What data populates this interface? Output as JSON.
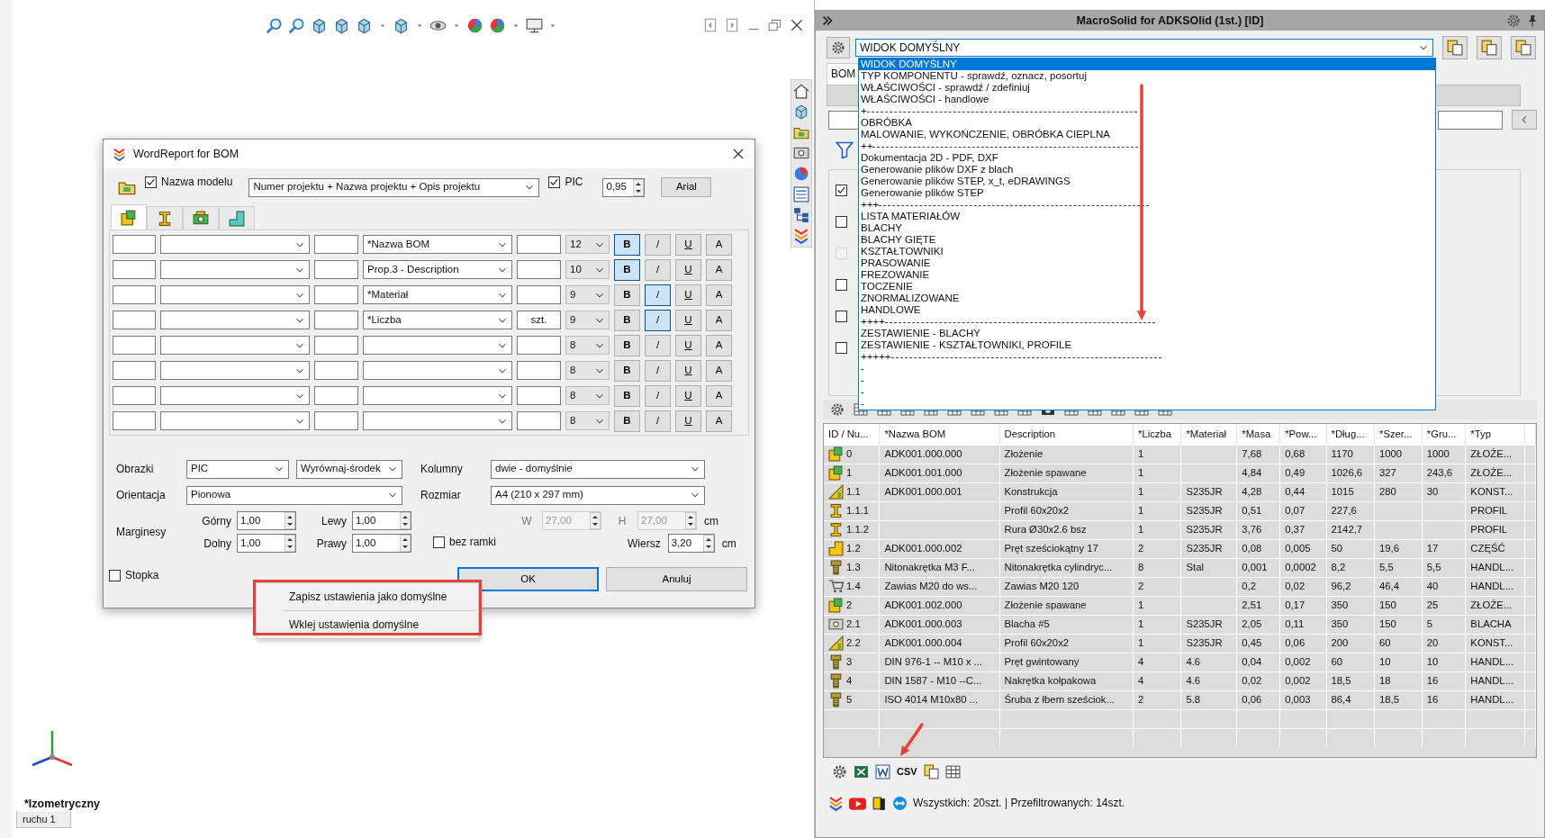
{
  "viewport": {
    "view_name": "*Izometryczny",
    "sheet_tab": "ruchu 1"
  },
  "dialog": {
    "title": "WordReport for BOM",
    "model_name": {
      "label": "Nazwa modelu",
      "checked": true
    },
    "title_source": "Numer projektu + Nazwa projektu + Opis projektu",
    "pic": {
      "label": "PIC",
      "checked": true
    },
    "scale": "0,95",
    "font_button": "Arial",
    "tabs": [
      {
        "kind": "assembly",
        "selected": true
      },
      {
        "kind": "profile",
        "selected": false
      },
      {
        "kind": "sheet",
        "selected": false
      },
      {
        "kind": "part",
        "selected": false
      }
    ],
    "rows": [
      {
        "property": "*Nazwa BOM",
        "size": "12",
        "styles": [
          {
            "label": "B",
            "selected": true
          },
          {
            "label": "/",
            "selected": false
          },
          {
            "label": "U",
            "selected": false
          },
          {
            "label": "A",
            "selected": false
          }
        ]
      },
      {
        "property": "Prop.3 - Description",
        "size": "10",
        "styles": [
          {
            "label": "B",
            "selected": true
          },
          {
            "label": "/",
            "selected": false
          },
          {
            "label": "U",
            "selected": false
          },
          {
            "label": "A",
            "selected": false
          }
        ]
      },
      {
        "property": "*Materiał",
        "size": "9",
        "styles": [
          {
            "label": "B",
            "selected": false
          },
          {
            "label": "/",
            "selected": true
          },
          {
            "label": "U",
            "selected": false
          },
          {
            "label": "A",
            "selected": false
          }
        ]
      },
      {
        "property": "*Liczba",
        "unit": "szt.",
        "size": "9",
        "styles": [
          {
            "label": "B",
            "selected": false
          },
          {
            "label": "/",
            "selected": true
          },
          {
            "label": "U",
            "selected": false
          },
          {
            "label": "A",
            "selected": false
          }
        ]
      },
      {
        "size": "8",
        "styles": [
          {
            "label": "B",
            "selected": false
          },
          {
            "label": "/",
            "selected": false
          },
          {
            "label": "U",
            "selected": false
          },
          {
            "label": "A",
            "selected": false
          }
        ]
      },
      {
        "size": "8",
        "styles": [
          {
            "label": "B",
            "selected": false
          },
          {
            "label": "/",
            "selected": false
          },
          {
            "label": "U",
            "selected": false
          },
          {
            "label": "A",
            "selected": false
          }
        ]
      },
      {
        "size": "8",
        "styles": [
          {
            "label": "B",
            "selected": false
          },
          {
            "label": "/",
            "selected": false
          },
          {
            "label": "U",
            "selected": false
          },
          {
            "label": "A",
            "selected": false
          }
        ]
      },
      {
        "size": "8",
        "styles": [
          {
            "label": "B",
            "selected": false
          },
          {
            "label": "/",
            "selected": false
          },
          {
            "label": "U",
            "selected": false
          },
          {
            "label": "A",
            "selected": false
          }
        ]
      }
    ],
    "images": {
      "label": "Obrazki",
      "source": "PIC",
      "align": "Wyrównaj-środek"
    },
    "columns": {
      "label": "Kolumny",
      "value": "dwie - domyślnie"
    },
    "orientation": {
      "label": "Orientacja",
      "value": "Pionowa"
    },
    "size": {
      "label": "Rozmiar",
      "value": "A4 (210 x 297 mm)"
    },
    "margins": {
      "label": "Marginesy",
      "fields": [
        {
          "label": "Górny",
          "value": "1,00"
        },
        {
          "label": "Lewy",
          "value": "1,00"
        },
        {
          "label": "Dolny",
          "value": "1,00"
        },
        {
          "label": "Prawy",
          "value": "1,00"
        }
      ]
    },
    "custom_size": [
      {
        "label": "W",
        "value": "27,00",
        "disabled": true
      },
      {
        "label": "H",
        "value": "27,00",
        "disabled": true
      }
    ],
    "custom_unit": "cm",
    "no_frame": {
      "label": "bez ramki",
      "checked": false
    },
    "row_height": {
      "label": "Wiersz",
      "value": "3,20",
      "unit": "cm"
    },
    "footer": {
      "label": "Stopka",
      "checked": false
    },
    "buttons": [
      {
        "label": "OK",
        "default": true
      },
      {
        "label": "Anuluj",
        "default": false
      }
    ]
  },
  "context_menu": {
    "items": [
      "Zapisz ustawienia jako domyślne",
      "Wklej ustawienia domyślne"
    ]
  },
  "panel": {
    "title": "MacroSolid for ADKSOlid (1st.) [ID]",
    "view_combo": "WIDOK DOMYŚLNY",
    "tab": "BOM",
    "filter_checks": [
      {
        "checked": true,
        "disabled": false
      },
      {
        "checked": false,
        "disabled": false
      },
      {
        "checked": false,
        "disabled": true
      },
      {
        "checked": false,
        "disabled": false
      },
      {
        "checked": false,
        "disabled": false
      },
      {
        "checked": false,
        "disabled": false
      }
    ],
    "dropdown": [
      {
        "kind": "option",
        "label": "WIDOK DOMYŚLNY",
        "selected": true
      },
      {
        "kind": "option",
        "label": "TYP KOMPONENTU - sprawdź, oznacz, posortuj",
        "selected": false
      },
      {
        "kind": "option",
        "label": "WŁAŚCIWOŚCI - sprawdź / zdefiniuj",
        "selected": false
      },
      {
        "kind": "option",
        "label": "WŁAŚCIWOŚCI - handlowe",
        "selected": false
      },
      {
        "kind": "separator",
        "label": "+"
      },
      {
        "kind": "option",
        "label": "OBRÓBKA",
        "selected": false
      },
      {
        "kind": "option",
        "label": "MALOWANIE, WYKOŃCZENIE, OBRÓBKA CIEPLNA",
        "selected": false
      },
      {
        "kind": "separator",
        "label": "++"
      },
      {
        "kind": "option",
        "label": "Dokumentacja 2D - PDF, DXF",
        "selected": false
      },
      {
        "kind": "option",
        "label": "Generowanie plików DXF z blach",
        "selected": false
      },
      {
        "kind": "option",
        "label": "Generowanie plików STEP, x_t, eDRAWINGS",
        "selected": false
      },
      {
        "kind": "option",
        "label": "Generowanie plików STEP",
        "selected": false
      },
      {
        "kind": "separator",
        "label": "+++"
      },
      {
        "kind": "option",
        "label": "LISTA MATERIAŁÓW",
        "selected": false
      },
      {
        "kind": "option",
        "label": "BLACHY",
        "selected": false
      },
      {
        "kind": "option",
        "label": "BLACHY GIĘTE",
        "selected": false
      },
      {
        "kind": "option",
        "label": "KSZTAŁTOWNIKI",
        "selected": false
      },
      {
        "kind": "option",
        "label": "PRASOWANIE",
        "selected": false
      },
      {
        "kind": "option",
        "label": "FREZOWANIE",
        "selected": false
      },
      {
        "kind": "option",
        "label": "TOCZENIE",
        "selected": false
      },
      {
        "kind": "option",
        "label": "ZNORMALIZOWANE",
        "selected": false
      },
      {
        "kind": "option",
        "label": "HANDLOWE",
        "selected": false
      },
      {
        "kind": "separator",
        "label": "++++"
      },
      {
        "kind": "option",
        "label": "ZESTAWIENIE - BLACHY",
        "selected": false
      },
      {
        "kind": "option",
        "label": "ZESTAWIENIE - KSZTAŁTOWNIKI, PROFILE",
        "selected": false
      },
      {
        "kind": "separator",
        "label": "+++++"
      },
      {
        "kind": "option",
        "label": "-",
        "selected": false
      },
      {
        "kind": "option",
        "label": "-",
        "selected": false
      },
      {
        "kind": "option",
        "label": "-",
        "selected": false
      },
      {
        "kind": "option",
        "label": "-",
        "selected": false
      }
    ],
    "table": {
      "columns": [
        "ID / Nu...",
        "*Nazwa BOM",
        "Description",
        "*Liczba",
        "*Materiał",
        "*Masa",
        "*Pow...",
        "*Dług...",
        "*Szer...",
        "*Gru...",
        "*Typ"
      ],
      "rows": [
        {
          "kind": "assembly",
          "cells": [
            "0",
            "ADK001.000.000",
            "Złożenie",
            "1",
            null,
            "7,68",
            "0,68",
            "1170",
            "1000",
            "1000",
            "ZŁOŻE..."
          ]
        },
        {
          "kind": "assembly",
          "cells": [
            "1",
            "ADK001.001.000",
            "Złożenie spawane",
            "1",
            null,
            "4,84",
            "0,49",
            "1026,6",
            "327",
            "243,6",
            "ZŁOŻE..."
          ]
        },
        {
          "kind": "weldment",
          "cells": [
            "1.1",
            "ADK001.000.001",
            "Konstrukcja",
            "1",
            "S235JR",
            "4,28",
            "0,44",
            "1015",
            "280",
            "30",
            "KONST..."
          ]
        },
        {
          "kind": "profile",
          "cells": [
            "1.1.1",
            null,
            "Profil 60x20x2",
            "1",
            "S235JR",
            "0,51",
            "0,07",
            "227,6",
            null,
            null,
            "PROFIL"
          ]
        },
        {
          "kind": "profile",
          "cells": [
            "1.1.2",
            null,
            "Rura Ø30x2.6 bsz",
            "1",
            "S235JR",
            "3,76",
            "0,37",
            "2142,7",
            null,
            null,
            "PROFIL"
          ]
        },
        {
          "kind": "part",
          "cells": [
            "1.2",
            "ADK001.000.002",
            "Pręt sześciokątny 17",
            "2",
            "S235JR",
            "0,08",
            "0,005",
            "50",
            "19,6",
            "17",
            "CZĘŚĆ"
          ]
        },
        {
          "kind": "fastener",
          "cells": [
            "1.3",
            "Nitonakrętka M3 F...",
            "Nitonakrętka cylindryc...",
            "8",
            "Stal",
            "0,001",
            "0,0002",
            "8,2",
            "5,5",
            "5,5",
            "HANDL..."
          ]
        },
        {
          "kind": "cart",
          "cells": [
            "1.4",
            "Zawias M20 do ws...",
            "Zawias M20 120",
            "2",
            null,
            "0,2",
            "0,02",
            "96,2",
            "46,4",
            "40",
            "HANDL..."
          ]
        },
        {
          "kind": "assembly",
          "cells": [
            "2",
            "ADK001.002.000",
            "Złożenie spawane",
            "1",
            null,
            "2,51",
            "0,17",
            "350",
            "150",
            "25",
            "ZŁOŻE..."
          ]
        },
        {
          "kind": "sheet",
          "cells": [
            "2.1",
            "ADK001.000.003",
            "Blacha #5",
            "1",
            "S235JR",
            "2,05",
            "0,11",
            "350",
            "150",
            "5",
            "BLACHA"
          ]
        },
        {
          "kind": "weldment",
          "cells": [
            "2.2",
            "ADK001.000.004",
            "Profil 60x20x2",
            "1",
            "S235JR",
            "0,45",
            "0,06",
            "200",
            "60",
            "20",
            "KONST..."
          ]
        },
        {
          "kind": "fastener",
          "cells": [
            "3",
            "DIN 976-1 -- M10 x ...",
            "Pręt gwintowany",
            "4",
            "4.6",
            "0,04",
            "0,002",
            "60",
            "10",
            "10",
            "HANDL..."
          ]
        },
        {
          "kind": "fastener",
          "cells": [
            "4",
            "DIN 1587 - M10 --C...",
            "Nakrętka kołpakowa",
            "4",
            "4.6",
            "0,02",
            "0,002",
            "18,5",
            "18",
            "16",
            "HANDL..."
          ]
        },
        {
          "kind": "fastener",
          "cells": [
            "5",
            "ISO 4014 M10x80 ...",
            "Śruba z łbem sześciok...",
            "2",
            "5.8",
            "0,06",
            "0,003",
            "86,4",
            "18,5",
            "16",
            "HANDL..."
          ]
        }
      ]
    },
    "csv_button": "CSV",
    "status": "Wszystkich: 20szt. | Przefiltrowanych: 14szt."
  }
}
